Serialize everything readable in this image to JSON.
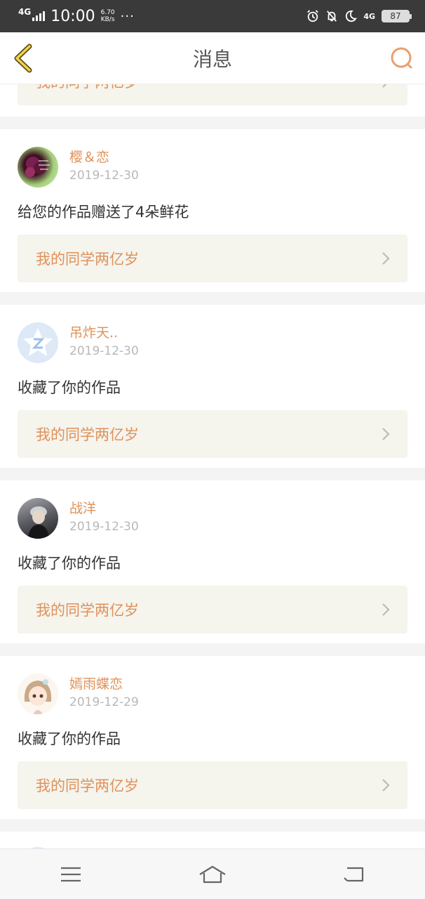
{
  "status_bar": {
    "network": "4G",
    "time": "10:00",
    "speed_value": "6.70",
    "speed_unit": "KB/s",
    "dots": "···",
    "network2": "4G",
    "battery": "87"
  },
  "header": {
    "title": "消息",
    "back_icon": "chevron-left-icon",
    "search_icon": "search-icon"
  },
  "partial_top": {
    "work_title": "我的同学两亿岁"
  },
  "messages": [
    {
      "username": "樱＆恋",
      "date": "2019-12-30",
      "action": "给您的作品赠送了4朵鲜花",
      "work_title": "我的同学两亿岁"
    },
    {
      "username": "吊炸天..",
      "date": "2019-12-30",
      "action": "收藏了你的作品",
      "work_title": "我的同学两亿岁"
    },
    {
      "username": "战洋",
      "date": "2019-12-30",
      "action": "收藏了你的作品",
      "work_title": "我的同学两亿岁"
    },
    {
      "username": "嫣雨蝶恋",
      "date": "2019-12-29",
      "action": "收藏了你的作品",
      "work_title": "我的同学两亿岁"
    }
  ],
  "nav": {
    "menu_icon": "menu-icon",
    "home_icon": "home-icon",
    "back_icon": "back-icon"
  },
  "colors": {
    "accent": "#e0915a",
    "card_link_bg": "#f5f4ed",
    "status_bar": "#3a3a3a"
  }
}
